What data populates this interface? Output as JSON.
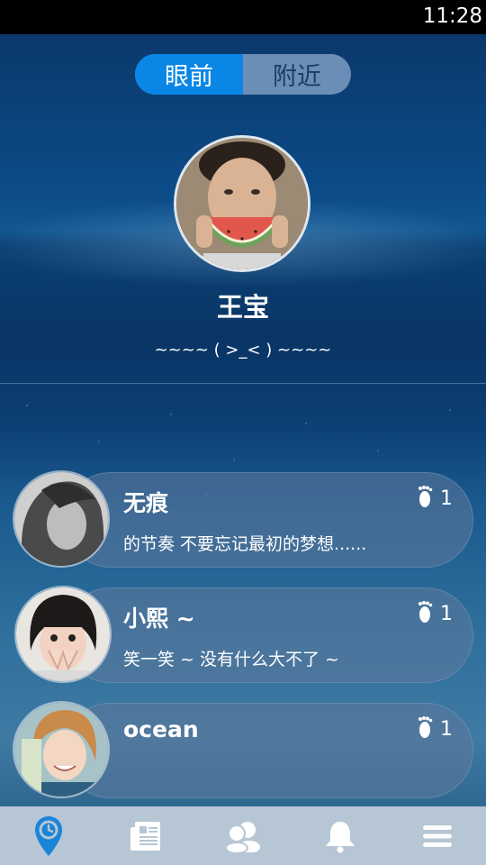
{
  "status_bar": {
    "time": "11:28"
  },
  "segment": {
    "tabs": [
      "眼前",
      "附近"
    ],
    "active_index": 0
  },
  "profile": {
    "name": "王宝",
    "signature": "~~~~ ( >_< ) ~~~~"
  },
  "people": [
    {
      "name": "无痕",
      "signature": "的节奏   不要忘记最初的梦想......",
      "steps": "1",
      "avatar_icon": "person-avatar"
    },
    {
      "name": "小熙 ~",
      "signature": "笑一笑 ~ 没有什么大不了 ~",
      "steps": "1",
      "avatar_icon": "person-avatar"
    },
    {
      "name": "ocean",
      "signature": "",
      "steps": "1",
      "avatar_icon": "person-avatar"
    }
  ],
  "bottom_nav": {
    "items": [
      "location-icon",
      "news-icon",
      "friends-icon",
      "bell-icon",
      "menu-icon"
    ],
    "active_index": 0,
    "active_color": "#1a84d8",
    "inactive_color": "#ffffff"
  },
  "colors": {
    "accent": "#0a86e6",
    "segment_inactive": "#8ca8cd"
  }
}
